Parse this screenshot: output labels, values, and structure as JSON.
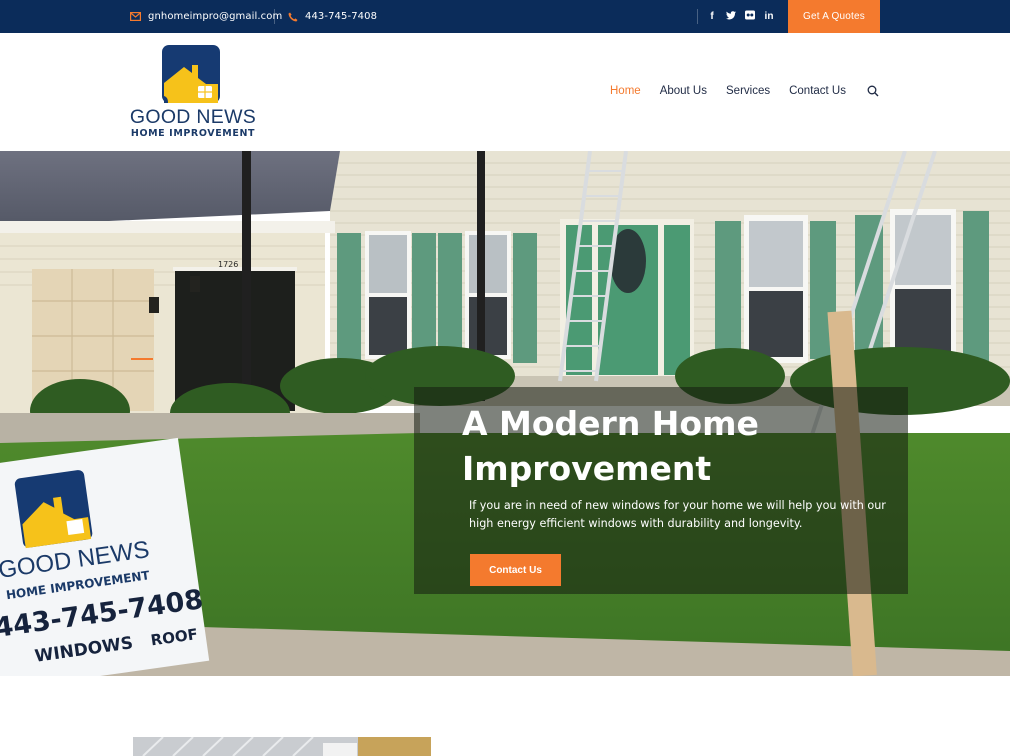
{
  "topbar": {
    "email": "gnhomeimpro@gmail.com",
    "phone": "443-745-7408",
    "socials": [
      {
        "name": "facebook",
        "glyph": "f"
      },
      {
        "name": "twitter",
        "glyph": "t"
      },
      {
        "name": "flickr",
        "glyph": "◘"
      },
      {
        "name": "linkedin",
        "glyph": "in"
      }
    ],
    "quote_button": "Get A Quotes"
  },
  "header": {
    "logo": {
      "name": "GOOD NEWS",
      "subtitle": "HOME IMPROVEMENT",
      "colors": {
        "tile": "#163a72",
        "house": "#f6c21a"
      }
    },
    "nav": [
      {
        "label": "Home",
        "active": true
      },
      {
        "label": "About Us",
        "active": false
      },
      {
        "label": "Services",
        "active": false
      },
      {
        "label": "Contact Us",
        "active": false
      }
    ]
  },
  "hero": {
    "title": "A Modern Home Improvement",
    "text": "If you are in need of new windows for your home we will help you with our high energy efficient windows with durability and longevity.",
    "button": "Contact Us",
    "photo": {
      "house_number": "1726",
      "yard_sign": {
        "brand_line1": "GOOD NEWS",
        "brand_line2": "HOME IMPROVEMENT",
        "phone": "443-745-7408",
        "services": [
          "WINDOWS",
          "ROOF"
        ]
      }
    }
  },
  "colors": {
    "accent": "#f47a2e",
    "topbar": "#0b2c5a",
    "nav_text": "#1f2a44"
  }
}
